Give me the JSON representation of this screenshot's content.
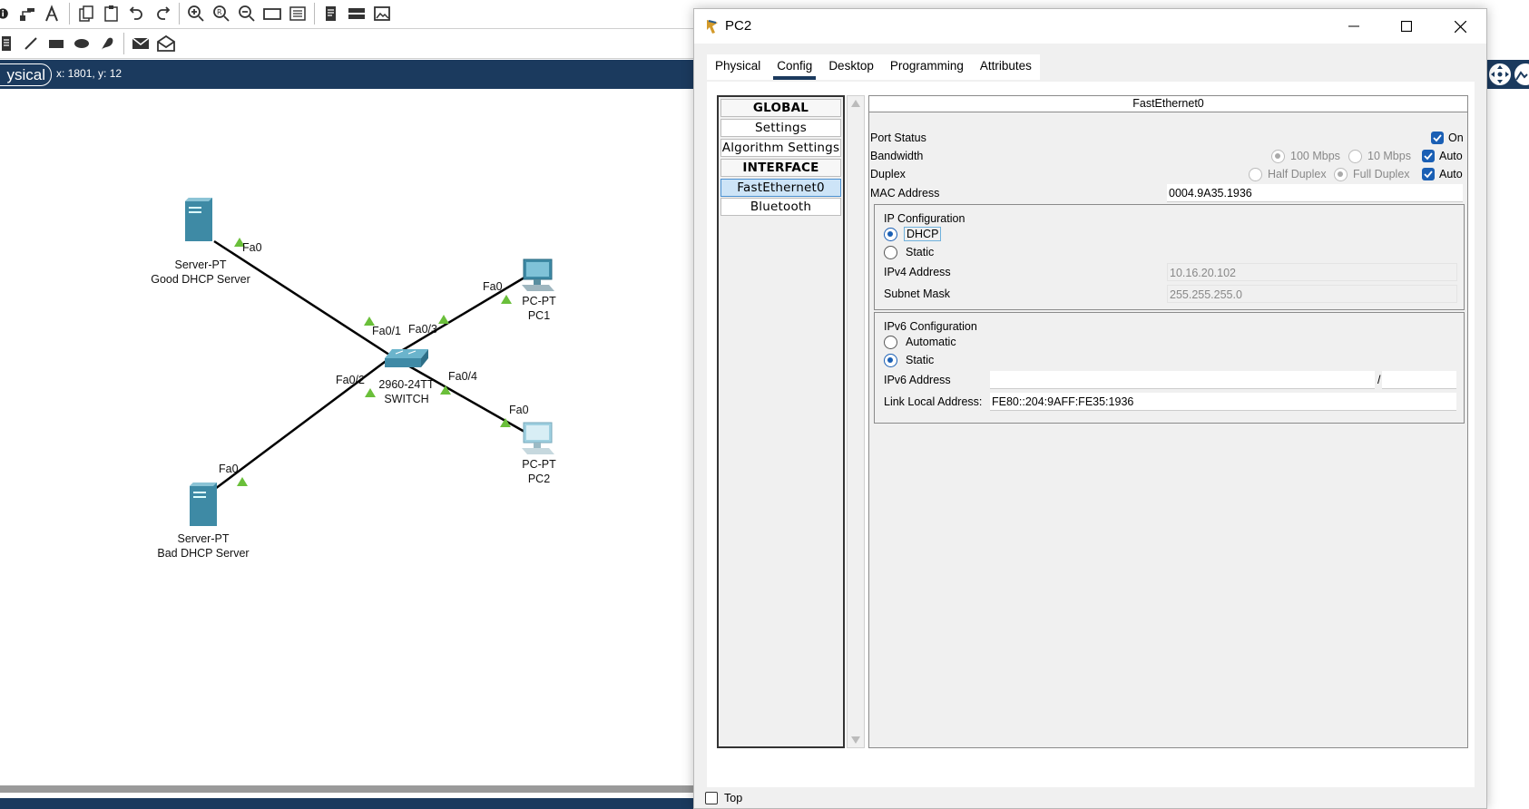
{
  "workspace": {
    "mode_tab": "ysical",
    "coords": "x: 1801, y: 12"
  },
  "toolbar_top": [
    "info-icon",
    "network-info-icon",
    "inspect-icon",
    "copy-icon",
    "paste-icon",
    "undo-icon",
    "redo-icon",
    "zoom-in-icon",
    "zoom-reset-icon",
    "zoom-out-icon",
    "rectangle-window-icon",
    "palette-icon",
    "notes-icon",
    "device-icon",
    "image-icon"
  ],
  "toolbar_second": [
    "note-icon",
    "line-icon",
    "rectangle-icon",
    "ellipse-icon",
    "freeform-icon",
    "simple-pdu-icon",
    "complex-pdu-icon"
  ],
  "topology": {
    "devices": [
      {
        "id": "good",
        "type": "server",
        "line1": "Server-PT",
        "line2": "Good DHCP Server"
      },
      {
        "id": "bad",
        "type": "server",
        "line1": "Server-PT",
        "line2": "Bad DHCP Server"
      },
      {
        "id": "pc1",
        "type": "pc",
        "line1": "PC-PT",
        "line2": "PC1"
      },
      {
        "id": "pc2",
        "type": "pc",
        "line1": "PC-PT",
        "line2": "PC2"
      },
      {
        "id": "sw",
        "type": "switch",
        "line1": "2960-24TT",
        "line2": "SWITCH"
      }
    ],
    "ports": [
      "Fa0",
      "Fa0/1",
      "Fa0/3",
      "Fa0",
      "Fa0/2",
      "Fa0/4",
      "Fa0",
      "Fa0"
    ]
  },
  "dialog": {
    "title": "PC2",
    "tabs": [
      "Physical",
      "Config",
      "Desktop",
      "Programming",
      "Attributes"
    ],
    "active_tab": "Config",
    "list": [
      {
        "label": "GLOBAL",
        "header": true
      },
      {
        "label": "Settings"
      },
      {
        "label": "Algorithm Settings"
      },
      {
        "label": "INTERFACE",
        "header": true
      },
      {
        "label": "FastEthernet0",
        "selected": true
      },
      {
        "label": "Bluetooth"
      }
    ],
    "interface": {
      "heading": "FastEthernet0",
      "port_status_label": "Port Status",
      "port_status_on": "On",
      "bandwidth_label": "Bandwidth",
      "bw_100": "100 Mbps",
      "bw_10": "10 Mbps",
      "bw_auto": "Auto",
      "duplex_label": "Duplex",
      "half": "Half Duplex",
      "full": "Full Duplex",
      "duplex_auto": "Auto",
      "mac_label": "MAC Address",
      "mac_value": "0004.9A35.1936",
      "ip_config_title": "IP Configuration",
      "dhcp": "DHCP",
      "static": "Static",
      "ipv4_label": "IPv4 Address",
      "ipv4_value": "10.16.20.102",
      "mask_label": "Subnet Mask",
      "mask_value": "255.255.255.0",
      "ipv6_config_title": "IPv6 Configuration",
      "v6_auto": "Automatic",
      "v6_static": "Static",
      "ipv6_label": "IPv6 Address",
      "ipv6_value": "",
      "ipv6_prefix": "",
      "slash": "/",
      "link_local_label": "Link Local Address:",
      "link_local_value": "FE80::204:9AFF:FE35:1936"
    },
    "top_checkbox": "Top"
  }
}
